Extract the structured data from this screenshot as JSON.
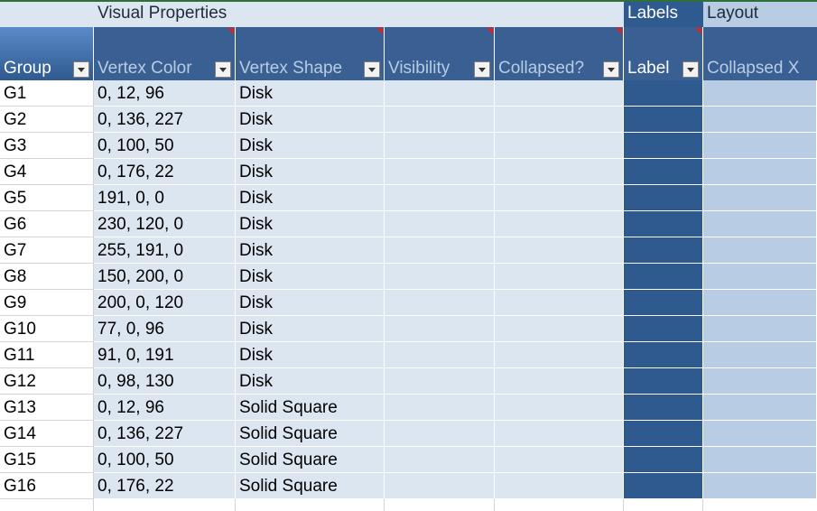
{
  "group_headers": {
    "visual": "Visual Properties",
    "labels": "Labels",
    "layout": "Layout"
  },
  "columns": [
    "Group",
    "Vertex Color",
    "Vertex Shape",
    "Visibility",
    "Collapsed?",
    "Label",
    "Collapsed X"
  ],
  "rows": [
    {
      "group": "G1",
      "color": "0, 12, 96",
      "shape": "Disk"
    },
    {
      "group": "G2",
      "color": "0, 136, 227",
      "shape": "Disk"
    },
    {
      "group": "G3",
      "color": "0, 100, 50",
      "shape": "Disk"
    },
    {
      "group": "G4",
      "color": "0, 176, 22",
      "shape": "Disk"
    },
    {
      "group": "G5",
      "color": "191, 0, 0",
      "shape": "Disk"
    },
    {
      "group": "G6",
      "color": "230, 120, 0",
      "shape": "Disk"
    },
    {
      "group": "G7",
      "color": "255, 191, 0",
      "shape": "Disk"
    },
    {
      "group": "G8",
      "color": "150, 200, 0",
      "shape": "Disk"
    },
    {
      "group": "G9",
      "color": "200, 0, 120",
      "shape": "Disk"
    },
    {
      "group": "G10",
      "color": "77, 0, 96",
      "shape": "Disk"
    },
    {
      "group": "G11",
      "color": "91, 0, 191",
      "shape": "Disk"
    },
    {
      "group": "G12",
      "color": "0, 98, 130",
      "shape": "Disk"
    },
    {
      "group": "G13",
      "color": "0, 12, 96",
      "shape": "Solid Square"
    },
    {
      "group": "G14",
      "color": "0, 136, 227",
      "shape": "Solid Square"
    },
    {
      "group": "G15",
      "color": "0, 100, 50",
      "shape": "Solid Square"
    },
    {
      "group": "G16",
      "color": "0, 176, 22",
      "shape": "Solid Square"
    }
  ]
}
